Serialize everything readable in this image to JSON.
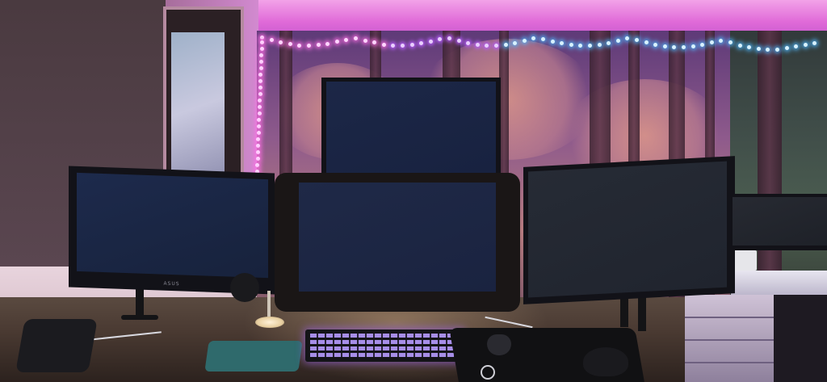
{
  "scene": {
    "description_free": true,
    "colors": {
      "ceiling_glow": "#e06ad8",
      "led_pink": "#ff6fe6",
      "led_blue": "#4fb8ff",
      "keyboard_backlight": "#b79cff",
      "mousepad_left": "#2f6a6c"
    }
  },
  "labels": {
    "monitor_left_brand": "ASUS"
  },
  "icons": {
    "mousepad_logo": "steelseries-logo-icon"
  }
}
